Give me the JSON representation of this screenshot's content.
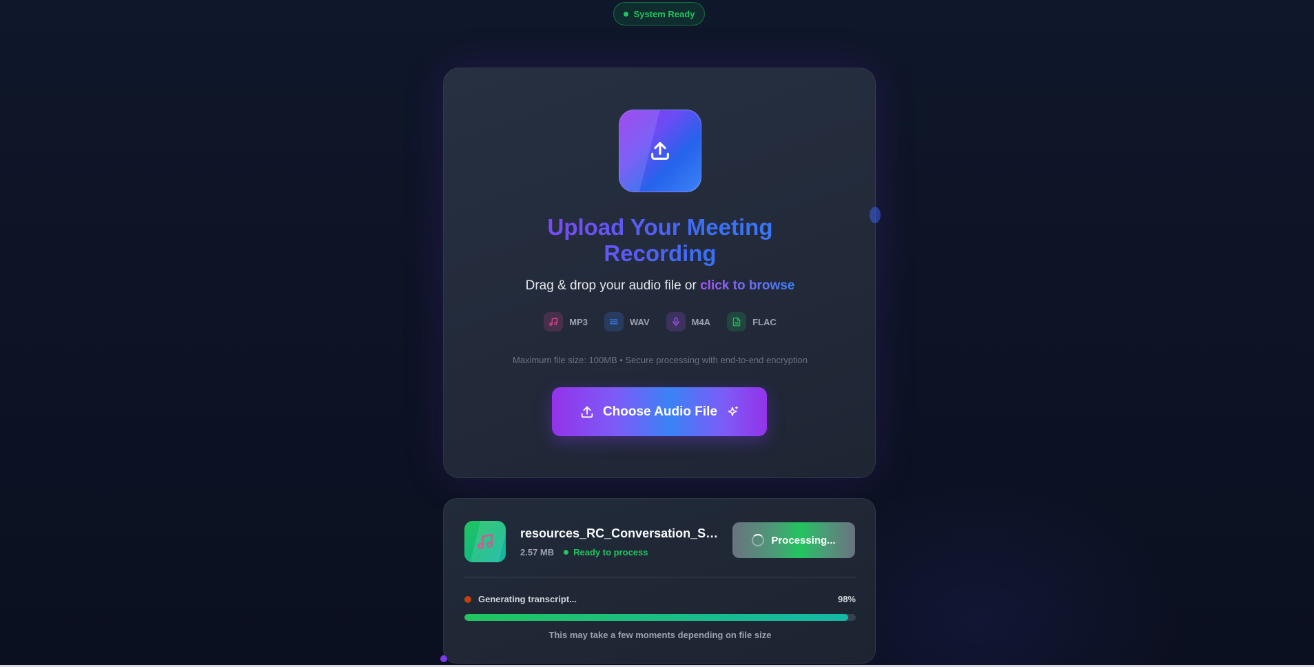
{
  "header": {
    "status_label": "System Ready",
    "status_color": "#22c55e"
  },
  "upload": {
    "icon": "upload-icon",
    "title_line1": "Upload Your Meeting",
    "title_line2": "Recording",
    "subtitle_prefix": "Drag & drop your audio file or ",
    "browse_link": "click to browse",
    "formats": [
      {
        "label": "MP3",
        "icon": "music-note-icon",
        "color": "#ec4899"
      },
      {
        "label": "WAV",
        "icon": "waveform-icon",
        "color": "#3b82f6"
      },
      {
        "label": "M4A",
        "icon": "microphone-icon",
        "color": "#a855f7"
      },
      {
        "label": "FLAC",
        "icon": "document-icon",
        "color": "#22c55e"
      }
    ],
    "limits_text": "Maximum file size: 100MB • Secure processing with end-to-end encryption",
    "choose_button": "Choose Audio File",
    "accent_start": "#9333ea",
    "accent_end": "#3b82f6"
  },
  "file": {
    "icon": "music-note-icon",
    "name": "resources_RC_Conversation_Sa...",
    "size": "2.57 MB",
    "status": "Ready to process",
    "processing_button": "Processing...",
    "progress_label": "Generating transcript...",
    "progress_percent_text": "98%",
    "progress_value": 0.98,
    "hint": "This may take a few moments depending on file size"
  }
}
